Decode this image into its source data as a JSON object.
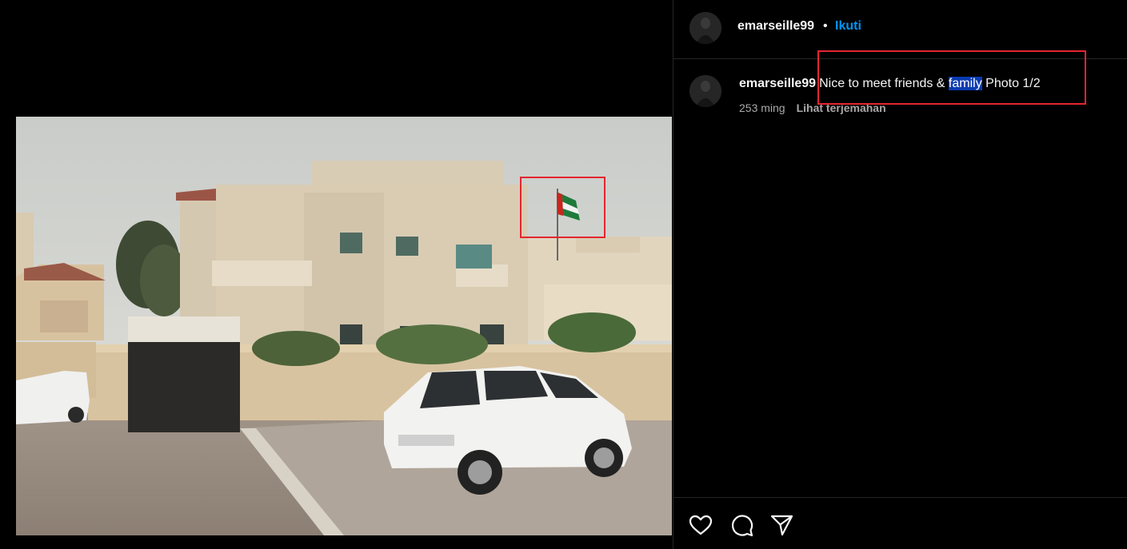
{
  "post": {
    "username": "emarseille99",
    "separator": "•",
    "follow_label": "Ikuti"
  },
  "caption": {
    "username": "emarseille99",
    "text_before": "Nice to meet friends & ",
    "text_highlight": "family",
    "text_after": " Photo 1/2",
    "time": "253 ming",
    "translate_label": "Lihat terjemahan"
  },
  "actions": {
    "icons": [
      "heart-icon",
      "comment-icon",
      "share-icon"
    ]
  },
  "colors": {
    "follow": "#0095f6",
    "annotation_box": "#e3262f",
    "highlight": "#0a3bb0"
  }
}
